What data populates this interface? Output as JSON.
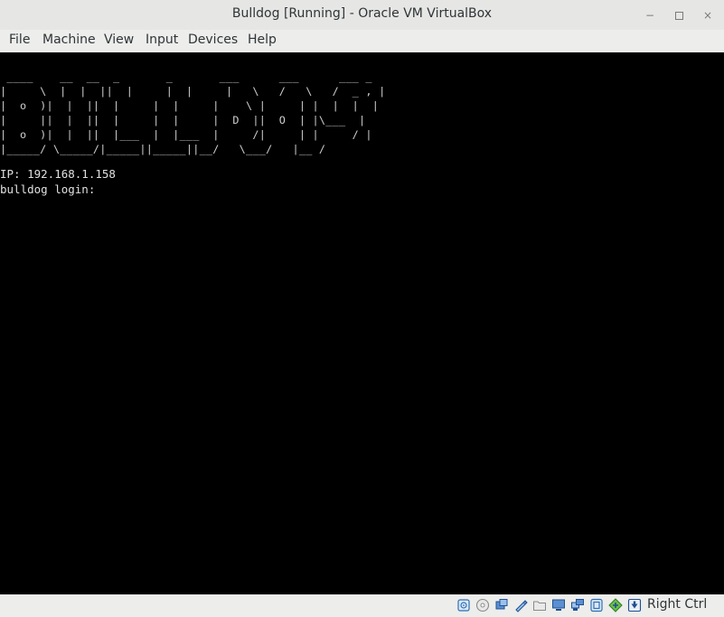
{
  "window": {
    "title": "Bulldog [Running] - Oracle VM VirtualBox",
    "minimize_glyph": "−",
    "close_glyph": "×"
  },
  "menu": [
    "File",
    "Machine",
    "View",
    "Input",
    "Devices",
    "Help"
  ],
  "screen": {
    "banner_art": " ____    __  __  _       _       ___      ___      ___ _\n|     \\  |  |  ||  |     |  |     |   \\   /   \\   /  _ , |\n|  o  )|  |  ||  |     |  |     |    \\ |     | |  |  |  |\n|     ||  |  ||  |     |  |     |  D  ||  O  | |\\___  |\n|  o  )|  |  ||  |___  |  |___  |     /|     | |     / |\n|_____/ \\_____/|_____||_____||__/   \\___/   |__ /",
    "lines": [
      "IP: 192.168.1.158",
      "bulldog login:"
    ]
  },
  "statusbar": {
    "icons": [
      "hard-disk-icon",
      "optical-drive-icon",
      "audio-icon",
      "usb-icon",
      "shared-folders-icon",
      "display-icon",
      "network-icon",
      "video-capture-icon",
      "guest-additions-icon",
      "mouse-integration-icon"
    ],
    "host_key": "Right Ctrl"
  }
}
